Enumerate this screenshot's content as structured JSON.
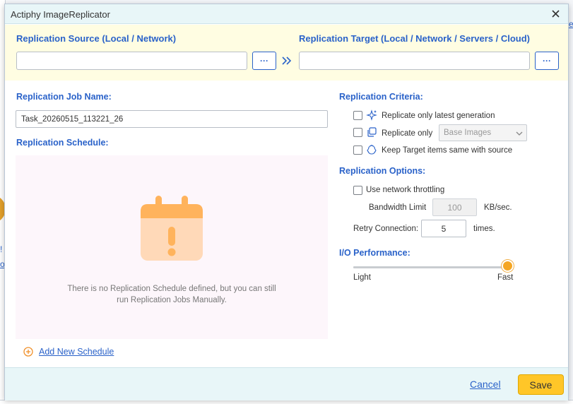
{
  "background": {
    "right_fragment": "e",
    "left_fragment_1": "!",
    "left_fragment_2": "o"
  },
  "dialog": {
    "title": "Actiphy ImageReplicator",
    "close_icon": "close-icon"
  },
  "source": {
    "label": "Replication Source (Local / Network)",
    "value": "",
    "browse_label": "···"
  },
  "target": {
    "label": "Replication Target (Local / Network / Servers / Cloud)",
    "value": "",
    "browse_label": "···"
  },
  "job": {
    "label": "Replication Job Name:",
    "value": "Task_20260515_113221_26"
  },
  "schedule": {
    "label": "Replication Schedule:",
    "empty_line1": "There is no Replication Schedule defined, but you can still",
    "empty_line2": "run Replication Jobs Manually.",
    "add_label": "Add New Schedule"
  },
  "criteria": {
    "label": "Replication Criteria:",
    "items": [
      {
        "label": "Replicate only latest generation",
        "checked": false,
        "icon": "sparkle-icon"
      },
      {
        "label": "Replicate only",
        "checked": false,
        "icon": "copy-icon"
      },
      {
        "label": "Keep Target items same with source",
        "checked": false,
        "icon": "recycle-icon"
      }
    ],
    "select_value": "Base Images"
  },
  "options": {
    "label": "Replication Options:",
    "throttle_label": "Use network throttling",
    "bandwidth_label": "Bandwidth Limit",
    "bandwidth_value": "100",
    "bandwidth_unit": "KB/sec.",
    "retry_label": "Retry Connection:",
    "retry_value": "5",
    "retry_unit": "times."
  },
  "performance": {
    "label": "I/O Performance:",
    "min_label": "Light",
    "max_label": "Fast",
    "level": 1.0
  },
  "footer": {
    "cancel_label": "Cancel",
    "save_label": "Save"
  },
  "colors": {
    "accent_blue": "#2a62c9",
    "save_yellow": "#ffc628",
    "slider_orange": "#f5a623",
    "calendar_orange": "#ffb35c"
  }
}
